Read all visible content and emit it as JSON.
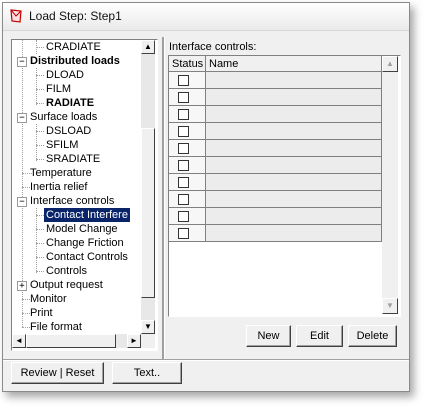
{
  "window": {
    "title": "Load Step: Step1"
  },
  "tree": {
    "items": [
      {
        "label": "CRADIATE",
        "bold": false
      },
      {
        "label": "Distributed loads",
        "bold": true
      },
      {
        "label": "DLOAD",
        "bold": false
      },
      {
        "label": "FILM",
        "bold": false
      },
      {
        "label": "RADIATE",
        "bold": true
      },
      {
        "label": "Surface loads",
        "bold": false
      },
      {
        "label": "DSLOAD",
        "bold": false
      },
      {
        "label": "SFILM",
        "bold": false
      },
      {
        "label": "SRADIATE",
        "bold": false
      },
      {
        "label": "Temperature",
        "bold": false
      },
      {
        "label": "Inertia relief",
        "bold": false
      },
      {
        "label": "Interface controls",
        "bold": false
      },
      {
        "label": "Contact Interfere",
        "bold": false,
        "selected": true
      },
      {
        "label": "Model Change",
        "bold": false
      },
      {
        "label": "Change Friction",
        "bold": false
      },
      {
        "label": "Contact Controls",
        "bold": false
      },
      {
        "label": "Controls",
        "bold": false
      },
      {
        "label": "Output request",
        "bold": false
      },
      {
        "label": "Monitor",
        "bold": false
      },
      {
        "label": "Print",
        "bold": false
      },
      {
        "label": "File format",
        "bold": false
      }
    ],
    "expander_minus": "−",
    "expander_plus": "+"
  },
  "interface_controls": {
    "label": "Interface controls:",
    "columns": [
      "Status",
      "Name"
    ],
    "row_count": 10
  },
  "buttons": {
    "new": "New",
    "edit": "Edit",
    "delete": "Delete",
    "review_reset": "Review | Reset",
    "text": "Text.."
  },
  "scroll_glyphs": {
    "up": "▲",
    "down": "▼",
    "left": "◄",
    "right": "►"
  },
  "colors": {
    "selection": "#0a246a",
    "window_bg": "#f0f0f0",
    "cell_bg": "#ececec"
  }
}
